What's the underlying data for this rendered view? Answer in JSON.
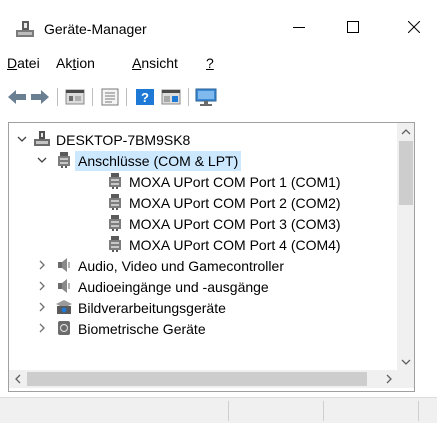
{
  "window": {
    "title": "Geräte-Manager",
    "icon": "device-manager-icon",
    "controls": [
      "minimize-icon",
      "maximize-icon",
      "close-icon"
    ]
  },
  "menu": [
    {
      "pre": "",
      "ul": "D",
      "post": "atei"
    },
    {
      "pre": "Ak",
      "ul": "t",
      "post": "ion"
    },
    {
      "pre": "",
      "ul": "A",
      "post": "nsicht"
    },
    {
      "pre": "",
      "ul": "?",
      "post": ""
    }
  ],
  "toolbar": [
    {
      "icon": "back-arrow-icon"
    },
    {
      "icon": "forward-arrow-icon"
    },
    {
      "icon": "properties-icon"
    },
    {
      "icon": "list-view-icon"
    },
    {
      "icon": "help-icon"
    },
    {
      "icon": "detail-view-icon"
    },
    {
      "icon": "monitor-icon"
    }
  ],
  "tree": [
    {
      "label": "DESKTOP-7BM9SK8",
      "icon": "computer-icon",
      "expander": "expanded",
      "level": 0
    },
    {
      "label": "Anschlüsse (COM & LPT)",
      "icon": "port-icon",
      "expander": "expanded",
      "level": 1,
      "selected": true
    },
    {
      "label": "MOXA UPort COM Port 1 (COM1)",
      "icon": "port-icon",
      "expander": "none",
      "level": 2
    },
    {
      "label": "MOXA UPort COM Port 2 (COM2)",
      "icon": "port-icon",
      "expander": "none",
      "level": 2
    },
    {
      "label": "MOXA UPort COM Port 3 (COM3)",
      "icon": "port-icon",
      "expander": "none",
      "level": 2
    },
    {
      "label": "MOXA UPort COM Port 4 (COM4)",
      "icon": "port-icon",
      "expander": "none",
      "level": 2
    },
    {
      "label": "Audio, Video und Gamecontroller",
      "icon": "speaker-icon",
      "expander": "collapsed",
      "level": 1
    },
    {
      "label": "Audioeingänge und -ausgänge",
      "icon": "speaker-icon",
      "expander": "collapsed",
      "level": 1
    },
    {
      "label": "Bildverarbeitungsgeräte",
      "icon": "camera-icon",
      "expander": "collapsed",
      "level": 1
    },
    {
      "label": "Biometrische Geräte",
      "icon": "biometric-icon",
      "expander": "collapsed",
      "level": 1
    }
  ],
  "colors": {
    "selection": "#cce8ff",
    "accent": "#1e78d6"
  }
}
